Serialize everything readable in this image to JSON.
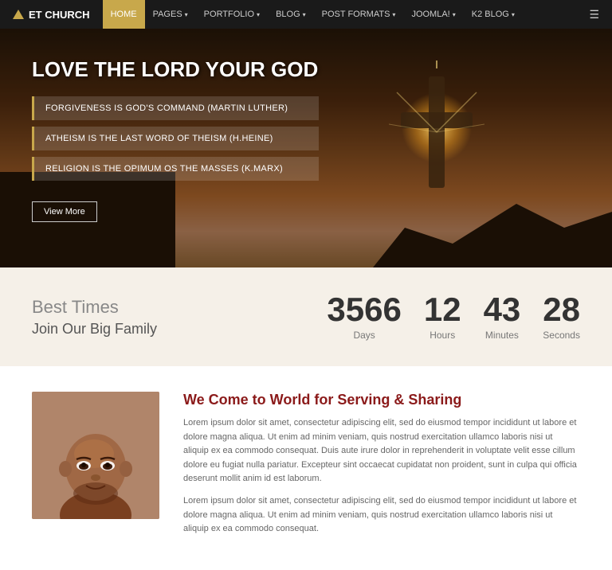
{
  "nav": {
    "logo_text": "ET CHURCH",
    "links": [
      {
        "label": "HOME",
        "active": true,
        "has_arrow": false
      },
      {
        "label": "PAGES",
        "active": false,
        "has_arrow": true
      },
      {
        "label": "PORTFOLIO",
        "active": false,
        "has_arrow": true
      },
      {
        "label": "BLOG",
        "active": false,
        "has_arrow": true
      },
      {
        "label": "POST FORMATS",
        "active": false,
        "has_arrow": true
      },
      {
        "label": "JOOMLA!",
        "active": false,
        "has_arrow": true
      },
      {
        "label": "K2 BLOG",
        "active": false,
        "has_arrow": true
      }
    ]
  },
  "hero": {
    "title": "LOVE THE LORD YOUR GOD",
    "quotes": [
      "FORGIVENESS IS GOD'S COMMAND (Martin Luther)",
      "ATHEISM IS THE LAST WORD OF THEISM (H.Heine)",
      "RELIGION IS THE OPIMUM OS THE MASSES (K.Marx)"
    ],
    "button_label": "View More"
  },
  "countdown": {
    "heading": "Best Times",
    "subheading": "Join Our Big Family",
    "items": [
      {
        "num": "3566",
        "label": "Days"
      },
      {
        "num": "12",
        "label": "Hours"
      },
      {
        "num": "43",
        "label": "Minutes"
      },
      {
        "num": "28",
        "label": "Seconds"
      }
    ]
  },
  "content": {
    "heading": "We Come to World for Serving & Sharing",
    "para1": "Lorem ipsum dolor sit amet, consectetur adipiscing elit, sed do eiusmod tempor incididunt ut labore et dolore magna aliqua. Ut enim ad minim veniam, quis nostrud exercitation ullamco laboris nisi ut aliquip ex ea commodo consequat. Duis aute irure dolor in reprehenderit in voluptate velit esse cillum dolore eu fugiat nulla pariatur. Excepteur sint occaecat cupidatat non proident, sunt in culpa qui officia deserunt mollit anim id est laborum.",
    "para2": "Lorem ipsum dolor sit amet, consectetur adipiscing elit, sed do eiusmod tempor incididunt ut labore et dolore magna aliqua. Ut enim ad minim veniam, quis nostrud exercitation ullamco laboris nisi ut aliquip ex ea commodo consequat."
  }
}
